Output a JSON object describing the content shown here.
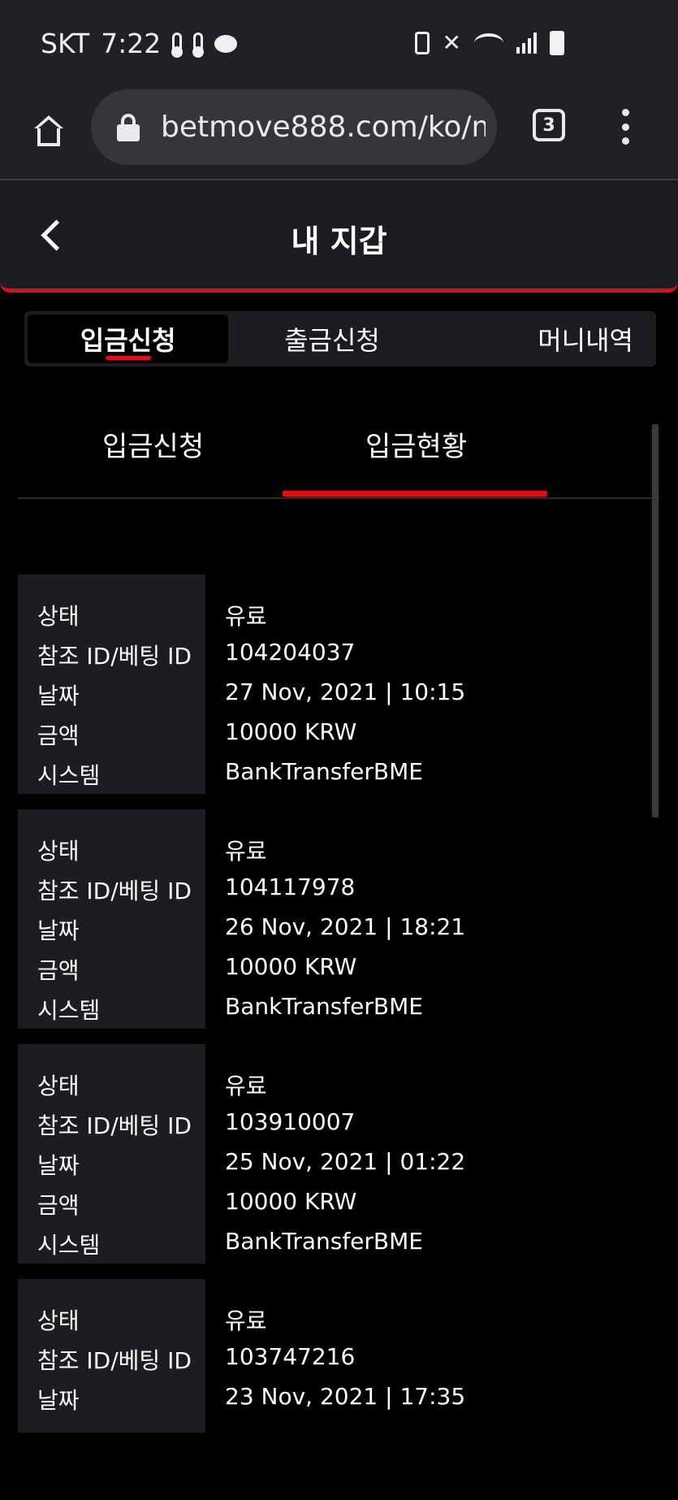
{
  "status_bar": {
    "carrier": "SKT",
    "time": "7:22"
  },
  "browser": {
    "url": "betmove888.com/ko/mi",
    "tab_count": "3"
  },
  "header": {
    "title": "내 지갑"
  },
  "main_tabs": [
    {
      "label": "입금신청",
      "active": true
    },
    {
      "label": "출금신청",
      "active": false
    },
    {
      "label": "머니내역",
      "active": false
    }
  ],
  "sub_tabs": [
    {
      "label": "입금신청",
      "active": false
    },
    {
      "label": "입금현황",
      "active": true
    }
  ],
  "labels": {
    "status": "상태",
    "ref_id": "참조 ID/베팅 ID",
    "date": "날짜",
    "amount": "금액",
    "system": "시스템"
  },
  "records": [
    {
      "status": "유료",
      "ref_id": "104204037",
      "date": "27 Nov, 2021 | 10:15",
      "amount": "10000 KRW",
      "system": "BankTransferBME"
    },
    {
      "status": "유료",
      "ref_id": "104117978",
      "date": "26 Nov, 2021 | 18:21",
      "amount": "10000 KRW",
      "system": "BankTransferBME"
    },
    {
      "status": "유료",
      "ref_id": "103910007",
      "date": "25 Nov, 2021 | 01:22",
      "amount": "10000 KRW",
      "system": "BankTransferBME"
    },
    {
      "status": "유료",
      "ref_id": "103747216",
      "date": "23 Nov, 2021 | 17:35",
      "amount": "",
      "system": ""
    }
  ],
  "colors": {
    "accent": "#e10e18",
    "panel": "#1c1d21",
    "background": "#000000"
  }
}
